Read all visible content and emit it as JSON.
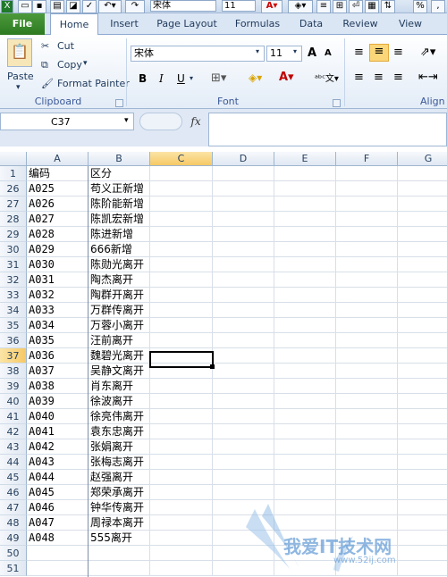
{
  "qat": {
    "font": "宋体",
    "size": "11"
  },
  "tabs": [
    "File",
    "Home",
    "Insert",
    "Page Layout",
    "Formulas",
    "Data",
    "Review",
    "View"
  ],
  "clipboard": {
    "paste": "Paste",
    "cut": "Cut",
    "copy": "Copy",
    "format_painter": "Format Painter",
    "group": "Clipboard"
  },
  "font": {
    "family": "宋体",
    "size": "11",
    "group": "Font",
    "grow": "A",
    "shrink": "A",
    "bold": "B",
    "italic": "I",
    "underline": "U"
  },
  "alignment": {
    "group": "Align"
  },
  "formula_bar": {
    "name_box": "C37",
    "fx": "fx",
    "content": ""
  },
  "columns": [
    "A",
    "B",
    "C",
    "D",
    "E",
    "F",
    "G"
  ],
  "selected_column": "C",
  "selected_row": "37",
  "rows": [
    {
      "n": "1",
      "a": "编码",
      "b": "区分"
    },
    {
      "n": "26",
      "a": "A025",
      "b": "苟义正新增"
    },
    {
      "n": "27",
      "a": "A026",
      "b": "陈阶能新增"
    },
    {
      "n": "28",
      "a": "A027",
      "b": "陈凯宏新增"
    },
    {
      "n": "29",
      "a": "A028",
      "b": "陈进新增"
    },
    {
      "n": "30",
      "a": "A029",
      "b": "666新增"
    },
    {
      "n": "31",
      "a": "A030",
      "b": "陈勋光离开"
    },
    {
      "n": "32",
      "a": "A031",
      "b": "陶杰离开"
    },
    {
      "n": "33",
      "a": "A032",
      "b": "陶群开离开"
    },
    {
      "n": "34",
      "a": "A033",
      "b": "万群传离开"
    },
    {
      "n": "35",
      "a": "A034",
      "b": "万蓉小离开"
    },
    {
      "n": "36",
      "a": "A035",
      "b": "汪前离开"
    },
    {
      "n": "37",
      "a": "A036",
      "b": "魏碧光离开"
    },
    {
      "n": "38",
      "a": "A037",
      "b": "吴静文离开"
    },
    {
      "n": "39",
      "a": "A038",
      "b": "肖东离开"
    },
    {
      "n": "40",
      "a": "A039",
      "b": "徐波离开"
    },
    {
      "n": "41",
      "a": "A040",
      "b": "徐亮伟离开"
    },
    {
      "n": "42",
      "a": "A041",
      "b": "袁东忠离开"
    },
    {
      "n": "43",
      "a": "A042",
      "b": "张娟离开"
    },
    {
      "n": "44",
      "a": "A043",
      "b": "张梅志离开"
    },
    {
      "n": "45",
      "a": "A044",
      "b": "赵强离开"
    },
    {
      "n": "46",
      "a": "A045",
      "b": "郑荣承离开"
    },
    {
      "n": "47",
      "a": "A046",
      "b": "钟华传离开"
    },
    {
      "n": "48",
      "a": "A047",
      "b": "周禄本离开"
    },
    {
      "n": "49",
      "a": "A048",
      "b": "555离开"
    },
    {
      "n": "50",
      "a": "",
      "b": ""
    },
    {
      "n": "51",
      "a": "",
      "b": ""
    }
  ],
  "watermark": {
    "text": "我爱IT技术网",
    "url": "www.52ij.com"
  },
  "colors": {
    "file_tab": "#2d7a21",
    "header_selected": "#f6c965",
    "ribbon_bg": "#dfe9f5"
  }
}
